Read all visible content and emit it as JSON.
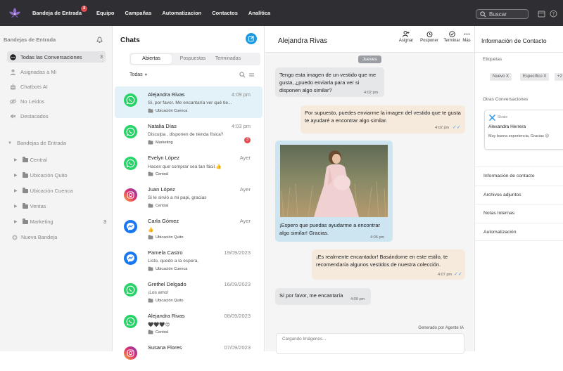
{
  "topbar": {
    "nav": [
      "Bandeja de Entrada",
      "Equipo",
      "Campañas",
      "Automatizacion",
      "Contactos",
      "Analítica"
    ],
    "inbox_badge": "3",
    "search_placeholder": "Buscar"
  },
  "sidebar": {
    "header": "Bandejas de Entrada",
    "items": [
      {
        "label": "Todas las Conversaciones",
        "count": "3",
        "icon": "chat-bubble-icon"
      },
      {
        "label": "Asignadas a Mi",
        "icon": "person-icon"
      },
      {
        "label": "Chatbots AI",
        "icon": "robot-icon"
      },
      {
        "label": "No Leídos",
        "icon": "eye-off-icon"
      },
      {
        "label": "Destacados",
        "icon": "megaphone-icon"
      }
    ],
    "inboxes_header": "Bandejas de Entrada",
    "inboxes": [
      {
        "label": "Central"
      },
      {
        "label": "Ubicación Quito"
      },
      {
        "label": "Ubicación Cuenca"
      },
      {
        "label": "Ventas"
      },
      {
        "label": "Marketing",
        "count": "3"
      }
    ],
    "new_inbox": "Nueva Bandeja"
  },
  "chats": {
    "title": "Chats",
    "tabs": [
      "Abiertas",
      "Pospuestas",
      "Terminadas"
    ],
    "filter": "Todas",
    "list": [
      {
        "name": "Alejandra Rivas",
        "time": "4:09 pm",
        "preview": "Sí, por favor. Me encantaría ver qué tie...",
        "tag": "Ubicación Cuenca",
        "channel": "whatsapp"
      },
      {
        "name": "Natalia Días",
        "time": "4:03 pm",
        "preview": "Disculpa , disponen de tienda física?",
        "tag": "Marketing",
        "channel": "whatsapp",
        "badge": "3"
      },
      {
        "name": "Evelyn López",
        "time": "Ayer",
        "preview": "Hacen que comprar sea tan fácil.👍",
        "tag": "Central",
        "channel": "whatsapp"
      },
      {
        "name": "Juan López",
        "time": "Ayer",
        "preview": "Si le sirvió a mi papi, gracias",
        "tag": "Central",
        "channel": "instagram"
      },
      {
        "name": "Carla Gómez",
        "time": "Ayer",
        "preview": "👍",
        "tag": "Ubicación Quito",
        "channel": "messenger"
      },
      {
        "name": "Pamela Castro",
        "time": "19/09/2023",
        "preview": "Listo, quedo a la espera.",
        "tag": "Ubicación Cuenca",
        "channel": "messenger"
      },
      {
        "name": "Grethel Delgado",
        "time": "16/09/2023",
        "preview": "¡Los amo!",
        "tag": "Ubicación Quito",
        "channel": "whatsapp"
      },
      {
        "name": "Alejandra Rivas",
        "time": "08/09/2023",
        "preview": "🖤🖤🖤😍",
        "tag": "Central",
        "channel": "whatsapp"
      },
      {
        "name": "Susana Flores",
        "time": "07/09/2023",
        "preview": "",
        "tag": "",
        "channel": "instagram"
      }
    ]
  },
  "conversation": {
    "contact_name": "Alejandra Rivas",
    "actions": [
      "Asignar",
      "Posponer",
      "Terminar",
      "Más"
    ],
    "day": "Jueves",
    "messages": [
      {
        "dir": "in",
        "text": "Tengo esta imagen de un vestido que me gusta, ¿puedo enviarla para ver si disponen algo similar?",
        "time": "4:02 pm"
      },
      {
        "dir": "out",
        "text": "Por supuesto, puedes enviarme la imagen del vestido que te gusta te ayudaré a encontrar algo similar.",
        "time": "4:02 pm"
      },
      {
        "dir": "in",
        "text": "¡Espero que puedas ayudarme a encontrar algo similar! Gracias.",
        "time": "4:06 pm"
      },
      {
        "dir": "out",
        "text": "¡Es realmente encantador! Basándome en este estilo, te recomendaría algunos vestidos de nuestra  colección.",
        "time": "4:07 pm"
      },
      {
        "dir": "in",
        "text": "Sí por favor, me encantaría",
        "time": "4:09 pm"
      }
    ],
    "generated_by": "Generado por Agente IA",
    "composer_text": "Cargando Imágenes..."
  },
  "contact_info": {
    "title": "Información de Contacto",
    "labels_title": "Etiquetas",
    "labels": [
      "Nuevo X",
      "Específico X",
      "+2"
    ],
    "other_title": "Otras Conversaciones",
    "card": {
      "channel": "Skrale",
      "name": "Alexandra Herrera",
      "text": "Muy buena experiencia, Gracias 😉"
    },
    "sections": [
      "Información de contacto",
      "Archivos adjuntos",
      "Notas Internas",
      "Automatización"
    ]
  },
  "colors": {
    "topbar": "#2f2f33",
    "accent": "#1d9be0",
    "whatsapp": "#25d366",
    "messenger": "#1877f2",
    "badge": "#e5484d"
  }
}
